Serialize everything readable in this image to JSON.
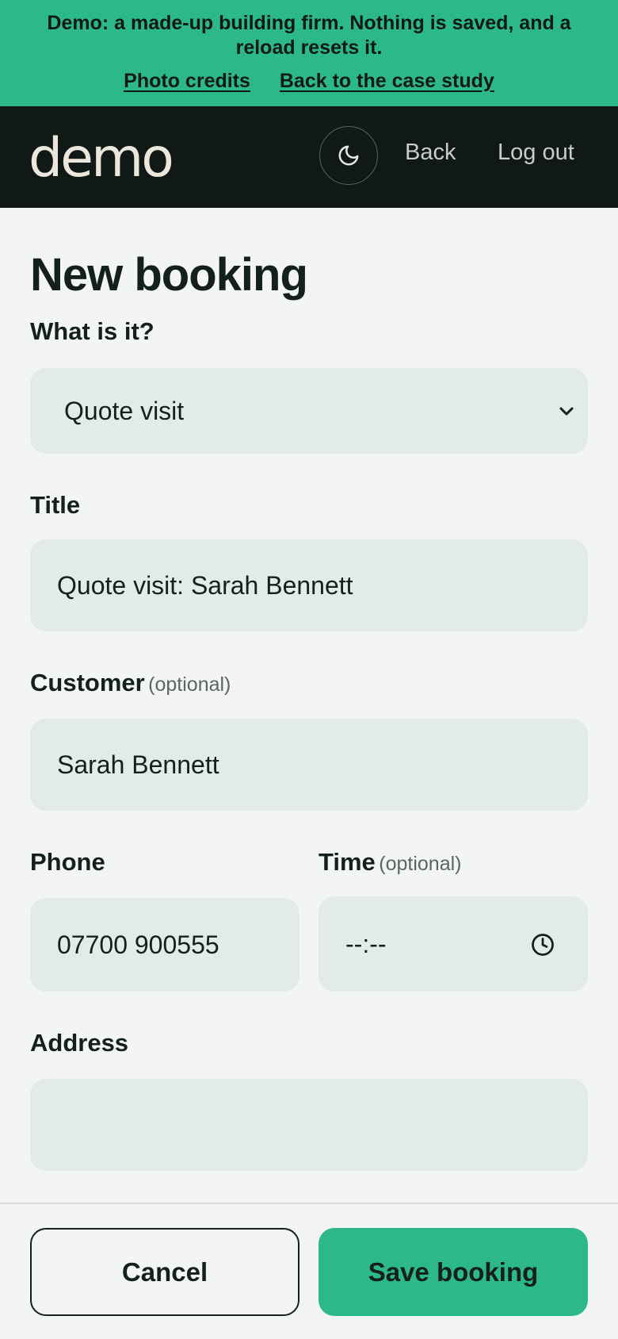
{
  "banner": {
    "text": "Demo: a made-up building firm. Nothing is saved, and a reload resets it.",
    "link_credits": "Photo credits",
    "link_case_study": "Back to the case study"
  },
  "header": {
    "logo": "demo",
    "theme_icon": "moon-icon",
    "back": "Back",
    "logout": "Log out"
  },
  "form": {
    "title": "New booking",
    "kind_label": "What is it?",
    "kind_value": "Quote visit",
    "title_label": "Title",
    "title_value": "Quote visit: Sarah Bennett",
    "customer_label": "Customer",
    "customer_optional": "(optional)",
    "customer_value": "Sarah Bennett",
    "phone_label": "Phone",
    "phone_value": "07700 900555",
    "time_label": "Time",
    "time_optional": "(optional)",
    "time_value": "--:--",
    "address_label": "Address",
    "address_value": ""
  },
  "actions": {
    "cancel": "Cancel",
    "save": "Save booking"
  },
  "colors": {
    "accent": "#2db88a",
    "header_bg": "#111917",
    "field_bg": "#e3ebe6"
  }
}
